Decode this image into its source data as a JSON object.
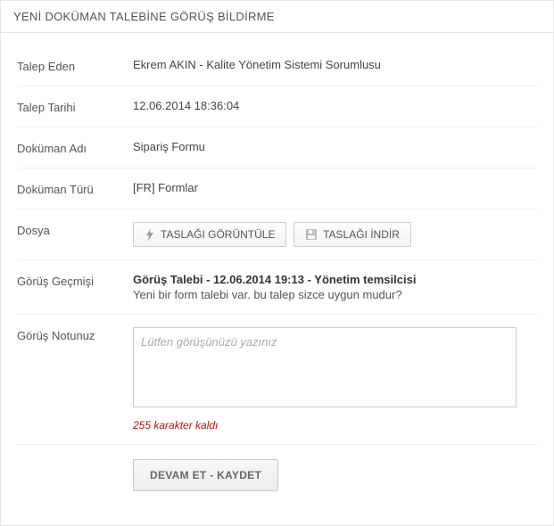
{
  "header": {
    "title": "YENİ DOKÜMAN TALEBİNE GÖRÜŞ BİLDİRME"
  },
  "fields": {
    "requester_label": "Talep Eden",
    "requester_value": "Ekrem AKIN - Kalite Yönetim Sistemi Sorumlusu",
    "request_date_label": "Talep Tarihi",
    "request_date_value": "12.06.2014 18:36:04",
    "doc_name_label": "Doküman Adı",
    "doc_name_value": "Sipariş Formu",
    "doc_type_label": "Doküman Türü",
    "doc_type_value": "[FR] Formlar",
    "file_label": "Dosya",
    "view_draft_btn": "TASLAĞI GÖRÜNTÜLE",
    "download_draft_btn": "TASLAĞI İNDİR",
    "history_label": "Görüş Geçmişi",
    "history_title": "Görüş Talebi - 12.06.2014 19:13 - Yönetim temsilcisi",
    "history_msg": "Yeni bir form talebi var. bu talep sizce uygun mudur?",
    "note_label": "Görüş Notunuz",
    "note_placeholder": "Lütfen görüşünüzü yazınız",
    "counter_text": "255 karakter kaldı",
    "submit_btn": "DEVAM ET - KAYDET"
  }
}
